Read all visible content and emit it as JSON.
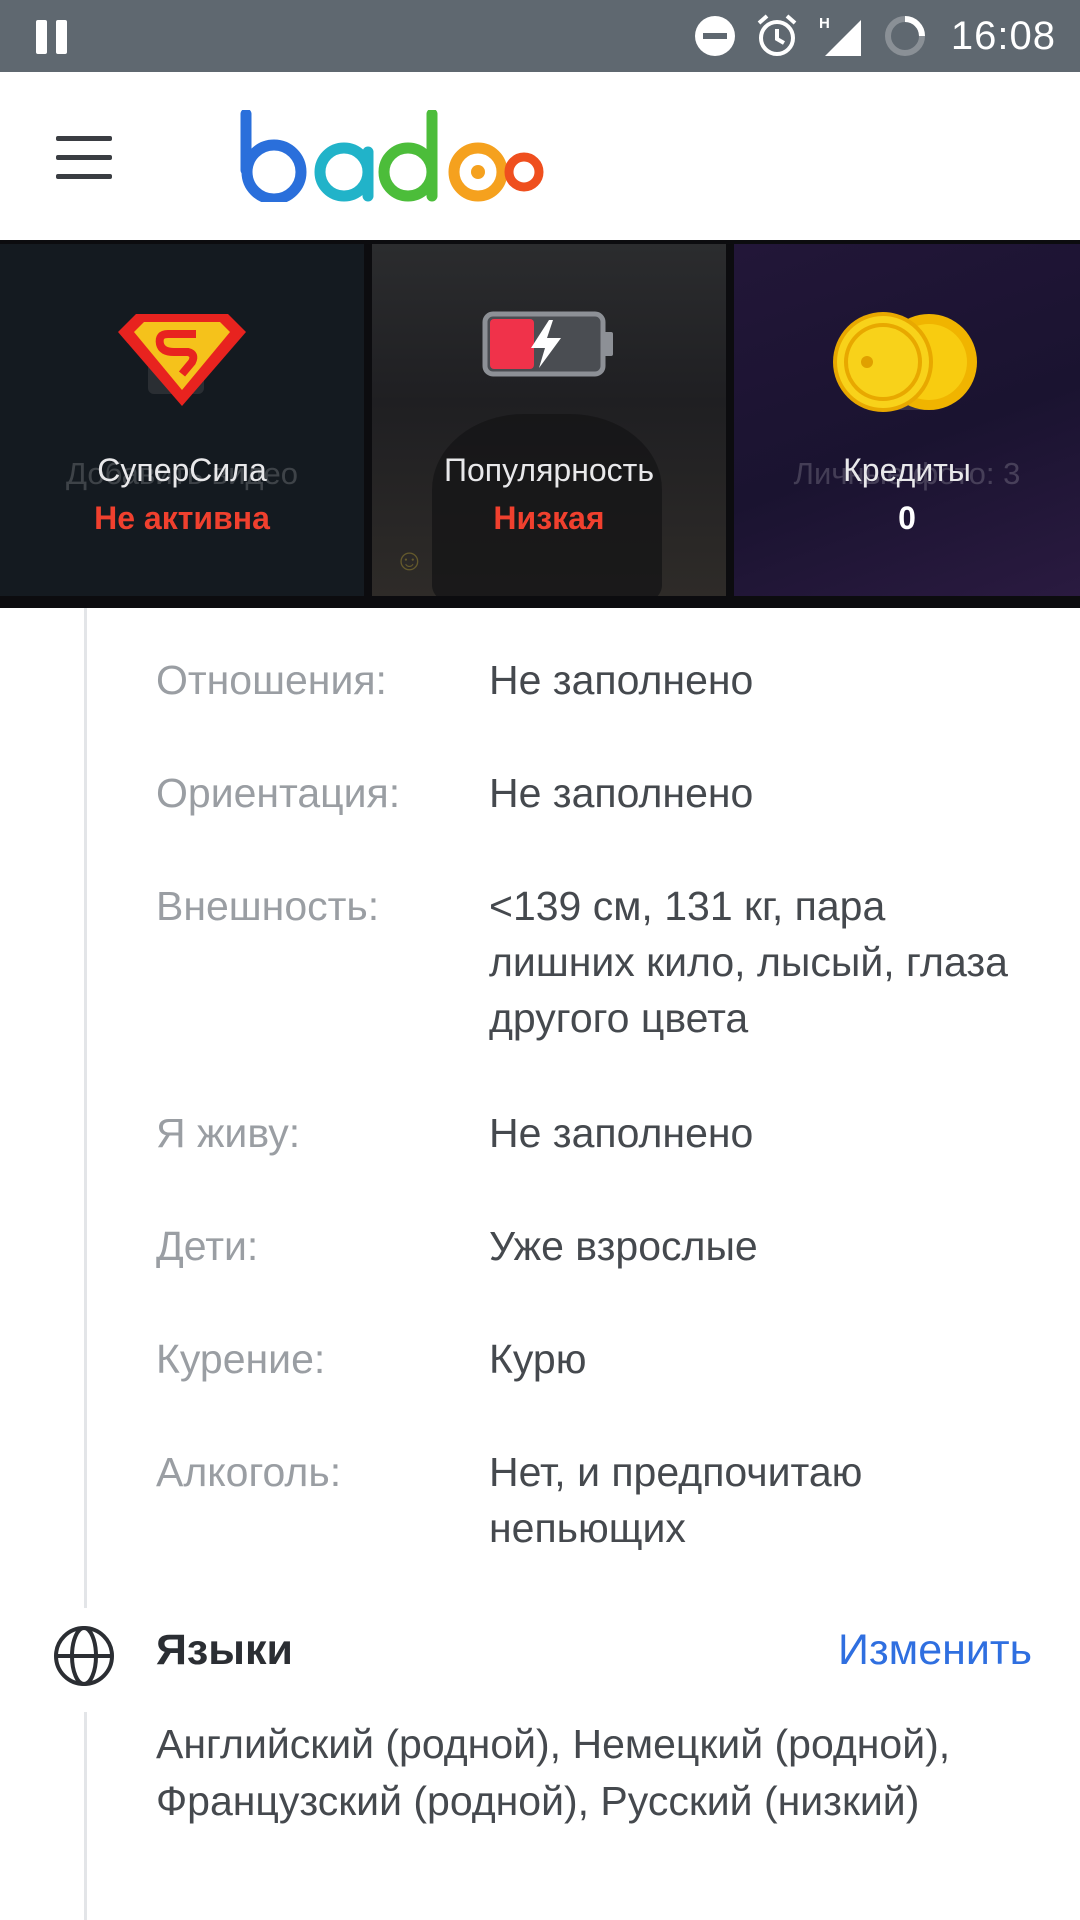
{
  "status_bar": {
    "time": "16:08",
    "network_label": "H",
    "icons": [
      "pause-icon",
      "dnd-icon",
      "alarm-icon",
      "signal-icon",
      "battery-icon"
    ]
  },
  "app_bar": {
    "logo_text": "badoo",
    "menu_icon": "hamburger-icon"
  },
  "stats": [
    {
      "label": "СуперСила",
      "value": "Не активна",
      "value_color": "#f0402e",
      "bg_text": "Добавить видео",
      "icon": "superpower-icon"
    },
    {
      "label": "Популярность",
      "value": "Низкая",
      "value_color": "#f0402e",
      "icon": "battery-low-icon"
    },
    {
      "label": "Кредиты",
      "value": "0",
      "value_color": "#ffffff",
      "bg_text": "Личные фото: 3",
      "icon": "coins-icon"
    }
  ],
  "details": [
    {
      "label": "Отношения:",
      "value": "Не заполнено"
    },
    {
      "label": "Ориентация:",
      "value": "Не заполнено"
    },
    {
      "label": "Внешность:",
      "value": "<139 см, 131 кг, пара лишних кило, лысый, глаза другого цвета"
    },
    {
      "label": "Я живу:",
      "value": "Не заполнено"
    },
    {
      "label": "Дети:",
      "value": "Уже взрослые"
    },
    {
      "label": "Курение:",
      "value": "Курю"
    },
    {
      "label": "Алкоголь:",
      "value": "Нет, и предпочитаю непьющих"
    }
  ],
  "languages": {
    "title": "Языки",
    "edit_label": "Изменить",
    "text": "Английский (родной), Немецкий (родной), Французский (родной), Русский (низкий)"
  },
  "colors": {
    "accent_blue": "#2f6fe0",
    "status_red": "#f0402e",
    "status_bar": "#5f6870"
  }
}
